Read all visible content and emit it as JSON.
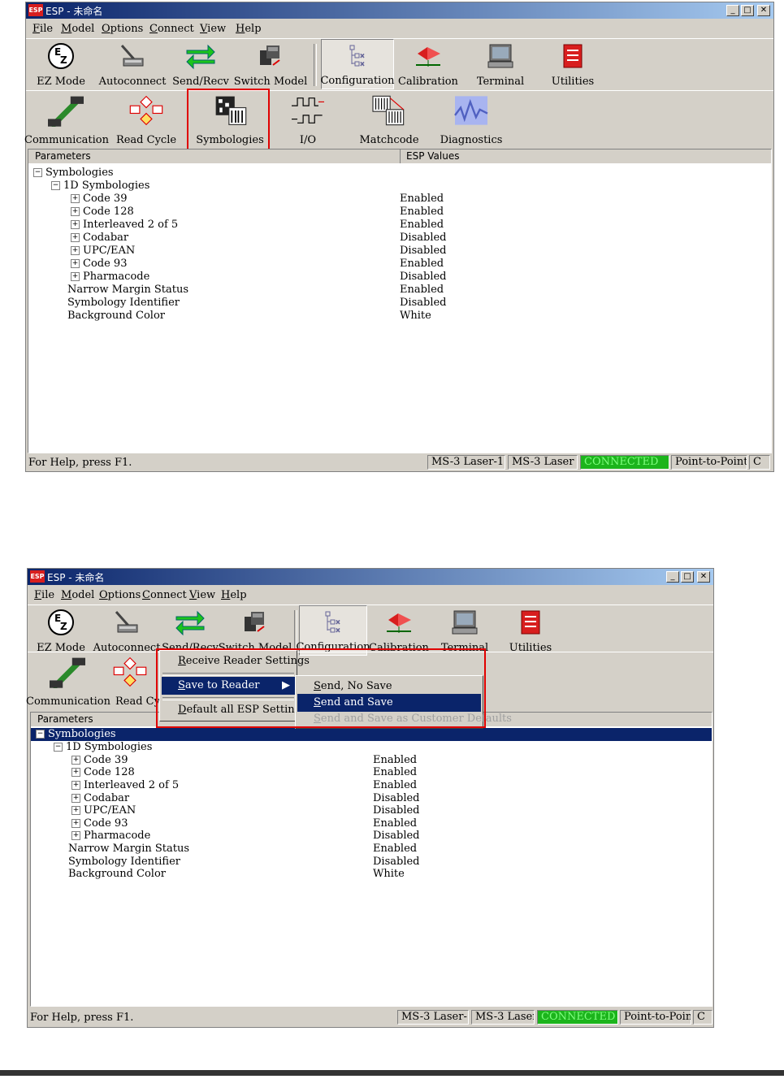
{
  "window": {
    "title": "ESP - 未命名",
    "app_icon": "ESP"
  },
  "menubar": [
    "File",
    "Model",
    "Options",
    "Connect",
    "View",
    "Help"
  ],
  "toolbar1": [
    "EZ Mode",
    "Autoconnect",
    "Send/Recv",
    "Switch Model",
    "Configuration",
    "Calibration",
    "Terminal",
    "Utilities"
  ],
  "toolbar2": [
    "Communication",
    "Read Cycle",
    "Symbologies",
    "I/O",
    "Matchcode",
    "Diagnostics"
  ],
  "toolbar2_partial": [
    "Communication",
    "Read Cyc"
  ],
  "columns": {
    "params": "Parameters",
    "values": "ESP Values"
  },
  "tree": {
    "root": "Symbologies",
    "group": "1D Symbologies",
    "items": [
      {
        "label": "Code 39",
        "value": "Enabled"
      },
      {
        "label": "Code 128",
        "value": "Enabled"
      },
      {
        "label": "Interleaved 2 of 5",
        "value": "Enabled"
      },
      {
        "label": "Codabar",
        "value": "Disabled"
      },
      {
        "label": "UPC/EAN",
        "value": "Disabled"
      },
      {
        "label": "Code 93",
        "value": "Enabled"
      },
      {
        "label": "Pharmacode",
        "value": "Disabled"
      }
    ],
    "extra": [
      {
        "label": "Narrow Margin Status",
        "value": "Enabled"
      },
      {
        "label": "Symbology Identifier",
        "value": "Disabled"
      },
      {
        "label": "Background Color",
        "value": "White"
      }
    ]
  },
  "status": {
    "help": "For Help, press F1.",
    "model1": "MS-3 Laser-1",
    "model2": "MS-3 Laser",
    "connection": "CONNECTED",
    "mode": "Point-to-Point",
    "extra": "C"
  },
  "context_menu": {
    "items": [
      "Receive Reader Settings",
      "Save to Reader",
      "Default all ESP Settings"
    ],
    "submenu": [
      "Send, No Save",
      "Send and Save",
      "Send and Save as Customer Defaults"
    ]
  },
  "colors": {
    "title_bar": "#0a246a",
    "selection": "#0a246a",
    "connected": "#1cb41c",
    "highlight_box": "#e00000"
  }
}
